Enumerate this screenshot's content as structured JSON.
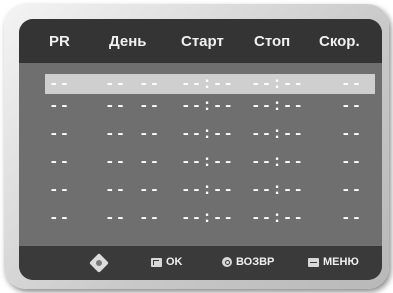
{
  "header": {
    "pr": "PR",
    "day": "День",
    "start": "Старт",
    "stop": "Стоп",
    "speed": "Скор."
  },
  "rows": [
    {
      "pr": "--",
      "day1": "--",
      "day2": "--",
      "start": "--:--",
      "stop": "--:--",
      "speed": "--"
    },
    {
      "pr": "--",
      "day1": "--",
      "day2": "--",
      "start": "--:--",
      "stop": "--:--",
      "speed": "--"
    },
    {
      "pr": "--",
      "day1": "--",
      "day2": "--",
      "start": "--:--",
      "stop": "--:--",
      "speed": "--"
    },
    {
      "pr": "--",
      "day1": "--",
      "day2": "--",
      "start": "--:--",
      "stop": "--:--",
      "speed": "--"
    },
    {
      "pr": "--",
      "day1": "--",
      "day2": "--",
      "start": "--:--",
      "stop": "--:--",
      "speed": "--"
    },
    {
      "pr": "--",
      "day1": "--",
      "day2": "--",
      "start": "--:--",
      "stop": "--:--",
      "speed": "--"
    }
  ],
  "footer": {
    "dpad_icon": "dpad-icon",
    "ok_label": "OK",
    "back_label": "ВОЗВР",
    "menu_label": "МЕНЮ"
  },
  "colors": {
    "screen": "#6f6f6f",
    "header": "#343434",
    "footer": "#3a3a3a",
    "selected_row": "#cfcfcf"
  }
}
